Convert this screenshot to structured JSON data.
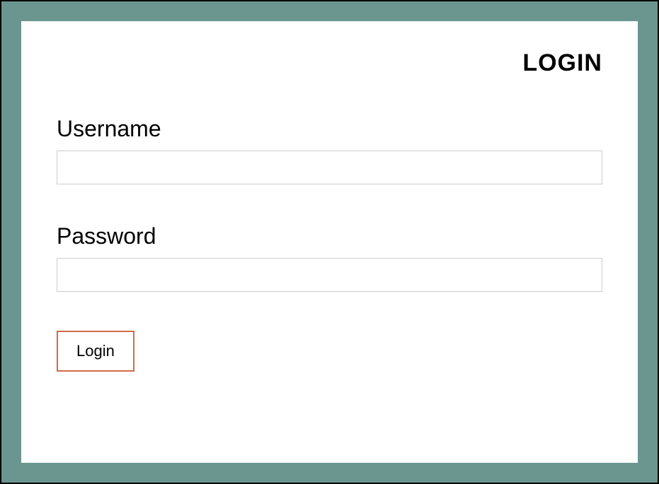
{
  "title": "LOGIN",
  "fields": {
    "username": {
      "label": "Username",
      "value": "",
      "placeholder": ""
    },
    "password": {
      "label": "Password",
      "value": "",
      "placeholder": ""
    }
  },
  "buttons": {
    "login": "Login"
  },
  "colors": {
    "frame_bg": "#6b9690",
    "button_border": "#d16a4a",
    "input_border": "#cccccc"
  }
}
